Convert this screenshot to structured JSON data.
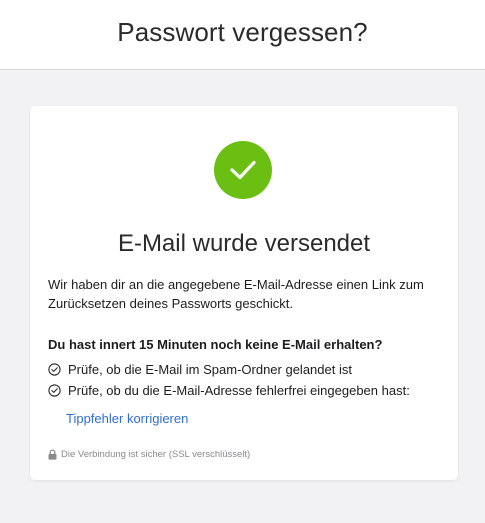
{
  "header": {
    "title": "Passwort vergessen?"
  },
  "card": {
    "icon": "checkmark-circle-icon",
    "title": "E-Mail wurde versendet",
    "intro": "Wir haben dir an die angegebene E-Mail-Adresse einen Link zum Zurücksetzen deines Passworts geschickt.",
    "subheading": "Du hast innert 15 Minuten noch keine E-Mail erhalten?",
    "tips": [
      {
        "icon": "check-circle-icon",
        "text": "Prüfe, ob die E-Mail im Spam-Ordner gelandet ist"
      },
      {
        "icon": "check-circle-icon",
        "text": "Prüfe, ob du die E-Mail-Adresse fehlerfrei eingegeben hast:"
      }
    ],
    "fix_link": "Tippfehler korrigieren",
    "ssl_icon": "lock-icon",
    "ssl_note": "Die Verbindung ist sicher (SSL verschlüsselt)"
  },
  "colors": {
    "success": "#6bbf12",
    "link": "#2f6fcb",
    "background": "#f2f2f4"
  }
}
